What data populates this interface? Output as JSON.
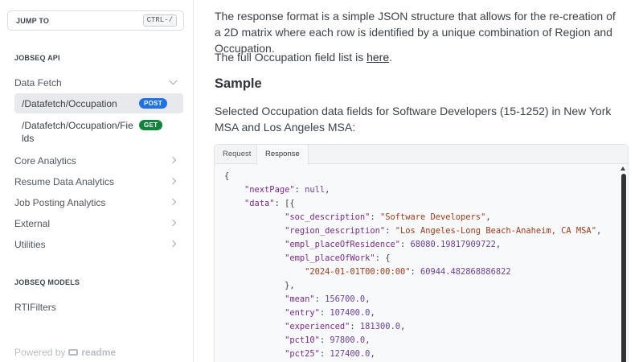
{
  "sidebar": {
    "jump_label": "JUMP TO",
    "jump_shortcut": "CTRL-/",
    "api_section": "JOBSEQ API",
    "data_fetch": "Data Fetch",
    "sub_items": [
      {
        "label": "/Datafetch/Occupation",
        "method": "POST"
      },
      {
        "label_line1": "/Datafetch/Occupation/Fie",
        "label_line2": "lds",
        "method": "GET"
      }
    ],
    "nav_items": [
      {
        "label": "Core Analytics"
      },
      {
        "label": "Resume Data Analytics"
      },
      {
        "label": "Job Posting Analytics"
      },
      {
        "label": "External"
      },
      {
        "label": "Utilities"
      }
    ],
    "models_section": "JOBSEQ MODELS",
    "model_item": "RTIFilters",
    "powered_by": "Powered by",
    "powered_logo": "readme"
  },
  "main": {
    "intro": "The response format is a simple JSON structure that allows for the re-creation of a 2D matrix where each row is identified by a unique combination of Region and Occupation.",
    "field_list_prefix": "The full Occupation field list is ",
    "field_list_link": "here",
    "field_list_suffix": ".",
    "sample_heading": "Sample",
    "sample_desc": "Selected Occupation data fields for Software Developers (15-1252) in New York MSA and Los Angeles MSA:",
    "tabs": [
      "Request",
      "Response"
    ],
    "active_tab": "Response"
  },
  "code": {
    "l1": "{",
    "nextPage_key": "\"nextPage\"",
    "nextPage_val": "null",
    "data_key": "\"data\"",
    "data_open": "[{",
    "soc_key": "\"soc_description\"",
    "soc_val": "\"Software Developers\"",
    "region_key": "\"region_description\"",
    "region_val": "\"Los Angeles-Long Beach-Anaheim, CA MSA\"",
    "residence_key": "\"empl_placeOfResidence\"",
    "residence_val": "68080.19817909722",
    "work_key": "\"empl_placeOfWork\"",
    "work_open": "{",
    "date_key": "\"2024-01-01T00:00:00\"",
    "date_val": "60944.482868886822",
    "work_close": "},",
    "mean_key": "\"mean\"",
    "mean_val": "156700.0",
    "entry_key": "\"entry\"",
    "entry_val": "107400.0",
    "exp_key": "\"experienced\"",
    "exp_val": "181300.0",
    "pct10_key": "\"pct10\"",
    "pct10_val": "97800.0",
    "pct25_key": "\"pct25\"",
    "pct25_val": "127400.0"
  }
}
